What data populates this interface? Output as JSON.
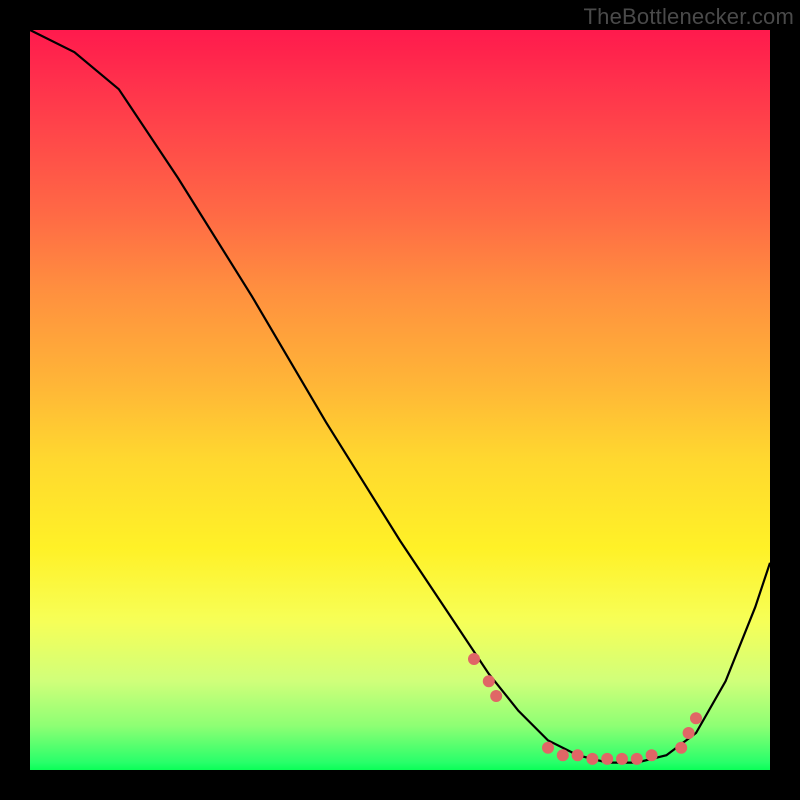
{
  "watermark": "TheBottlenecker.com",
  "chart_data": {
    "type": "line",
    "title": "",
    "xlabel": "",
    "ylabel": "",
    "xlim": [
      0,
      100
    ],
    "ylim": [
      0,
      100
    ],
    "series": [
      {
        "name": "curve",
        "color": "#000000",
        "x": [
          0,
          6,
          12,
          20,
          30,
          40,
          50,
          58,
          62,
          66,
          70,
          74,
          78,
          82,
          86,
          90,
          94,
          98,
          100
        ],
        "y": [
          100,
          97,
          92,
          80,
          64,
          47,
          31,
          19,
          13,
          8,
          4,
          2,
          1,
          1,
          2,
          5,
          12,
          22,
          28
        ]
      }
    ],
    "markers": {
      "name": "dots",
      "color": "#e06666",
      "points": [
        {
          "x": 60,
          "y": 15
        },
        {
          "x": 62,
          "y": 12
        },
        {
          "x": 63,
          "y": 10
        },
        {
          "x": 70,
          "y": 3
        },
        {
          "x": 72,
          "y": 2
        },
        {
          "x": 74,
          "y": 2
        },
        {
          "x": 76,
          "y": 1.5
        },
        {
          "x": 78,
          "y": 1.5
        },
        {
          "x": 80,
          "y": 1.5
        },
        {
          "x": 82,
          "y": 1.5
        },
        {
          "x": 84,
          "y": 2
        },
        {
          "x": 88,
          "y": 3
        },
        {
          "x": 89,
          "y": 5
        },
        {
          "x": 90,
          "y": 7
        }
      ]
    }
  }
}
